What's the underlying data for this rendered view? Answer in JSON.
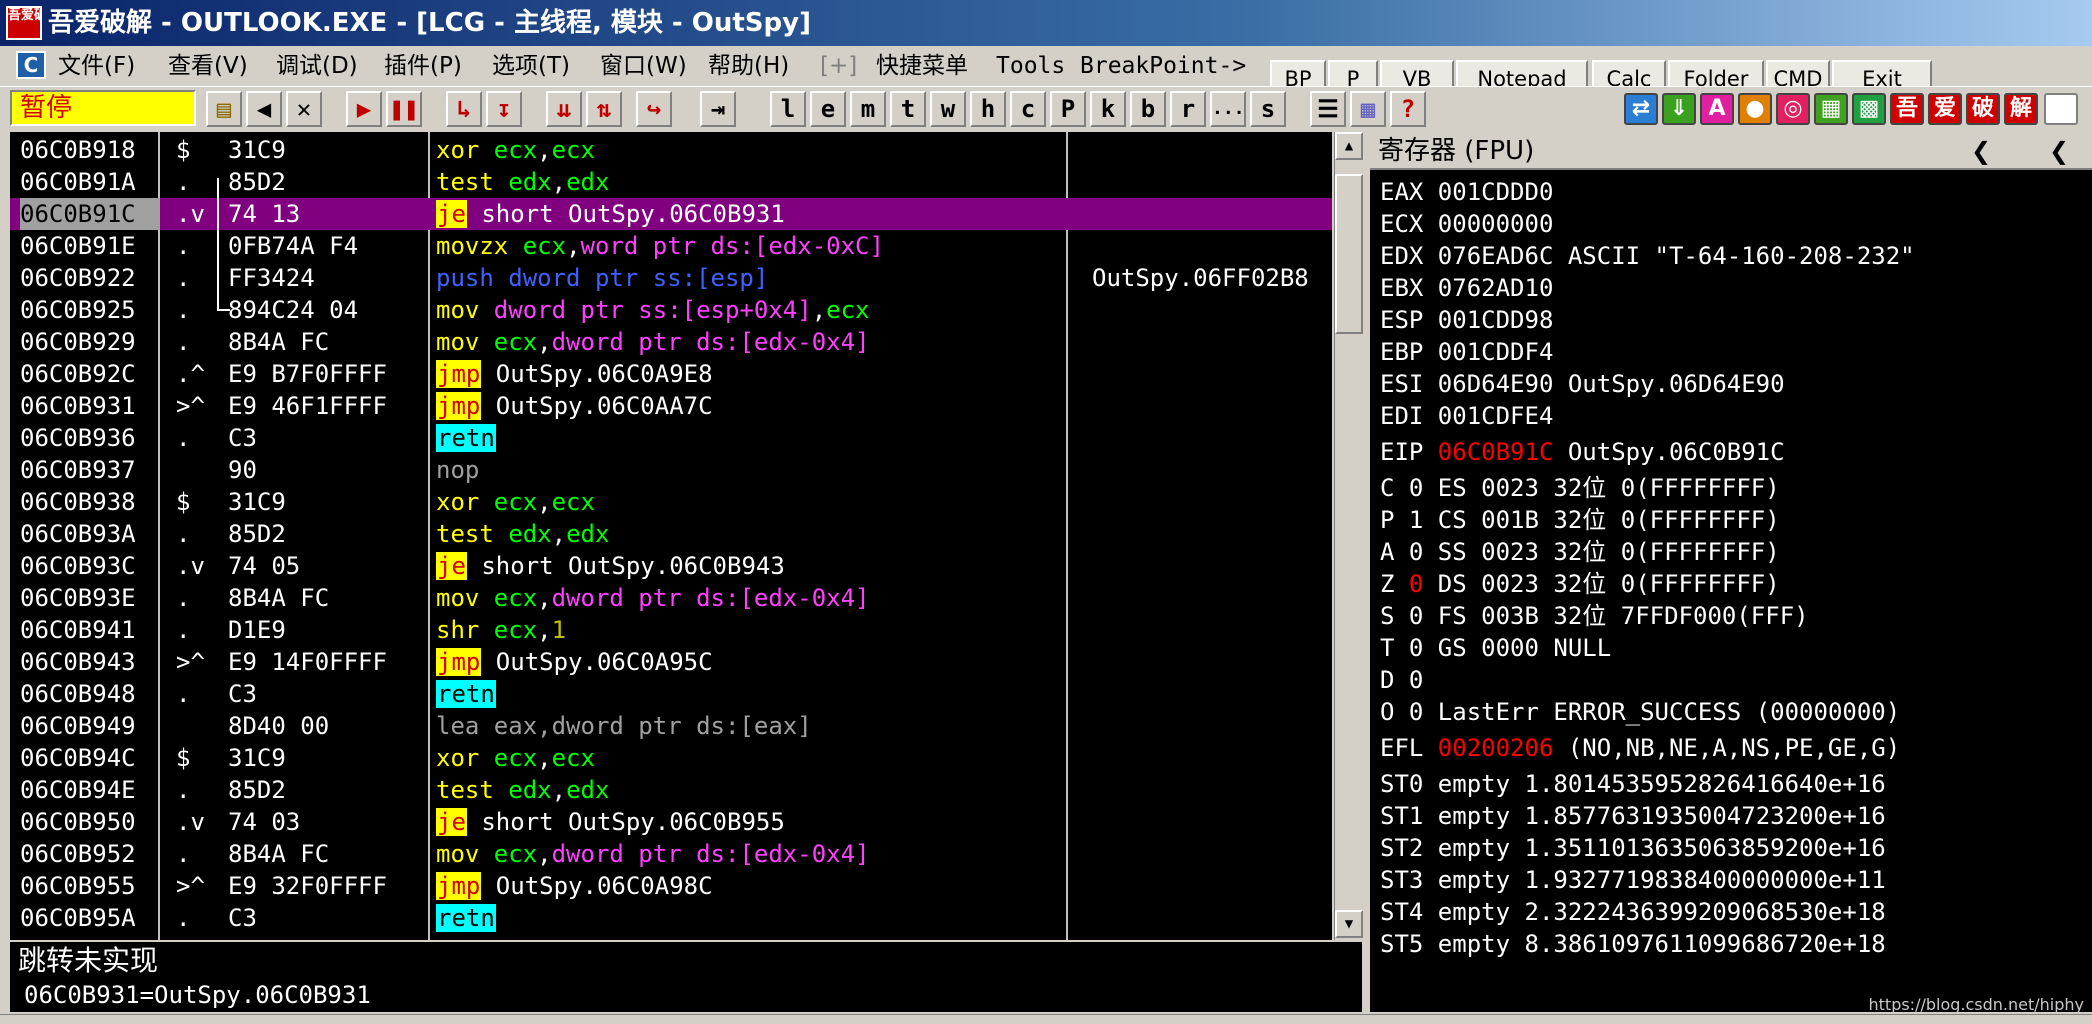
{
  "window": {
    "app_icon_text": "吾爱破解",
    "title": "吾爱破解 - OUTLOOK.EXE - [LCG - 主线程, 模块 - OutSpy]"
  },
  "menu": {
    "sys_icon": "C",
    "items": [
      "文件(F)",
      "查看(V)",
      "调试(D)",
      "插件(P)",
      "选项(T)",
      "窗口(W)",
      "帮助(H)",
      "[+]",
      "快捷菜单",
      "Tools",
      "BreakPoint->"
    ]
  },
  "quick_buttons": [
    "BP",
    "P",
    "VB",
    "Notepad",
    "Calc",
    "Folder",
    "CMD",
    "Exit"
  ],
  "toolbar": {
    "status": "暂停",
    "letters": [
      "l",
      "e",
      "m",
      "t",
      "w",
      "h",
      "c",
      "P",
      "k",
      "b",
      "r",
      "...",
      "s"
    ],
    "plugin_labels": [
      "A",
      "吾",
      "爱",
      "破",
      "解"
    ]
  },
  "disasm": {
    "rows": [
      {
        "addr": "06C0B918",
        "mark": "$",
        "hex": "31C9",
        "asm": [
          {
            "t": "xor ",
            "c": "yellow"
          },
          {
            "t": "ecx",
            "c": "green"
          },
          {
            "t": ",",
            "c": "white"
          },
          {
            "t": "ecx",
            "c": "green"
          }
        ],
        "comment": ""
      },
      {
        "addr": "06C0B91A",
        "mark": ".",
        "hex": "85D2",
        "asm": [
          {
            "t": "test ",
            "c": "yellow"
          },
          {
            "t": "edx",
            "c": "green"
          },
          {
            "t": ",",
            "c": "white"
          },
          {
            "t": "edx",
            "c": "green"
          }
        ],
        "comment": ""
      },
      {
        "addr": "06C0B91C",
        "mark": ".v",
        "hex": "74 13",
        "asm": [
          {
            "t": "je",
            "c": "jbox"
          },
          {
            "t": " short OutSpy.06C0B931",
            "c": "white"
          }
        ],
        "comment": "",
        "selected": true,
        "current": true
      },
      {
        "addr": "06C0B91E",
        "mark": ".",
        "hex": "0FB74A F4",
        "asm": [
          {
            "t": "movzx ",
            "c": "yellow"
          },
          {
            "t": "ecx",
            "c": "green"
          },
          {
            "t": ",",
            "c": "white"
          },
          {
            "t": "word ptr ds:[edx-0xC]",
            "c": "mag"
          }
        ],
        "comment": ""
      },
      {
        "addr": "06C0B922",
        "mark": ".",
        "hex": "FF3424",
        "asm": [
          {
            "t": "push dword ptr ss:[esp]",
            "c": "blue"
          }
        ],
        "comment": "OutSpy.06FF02B8"
      },
      {
        "addr": "06C0B925",
        "mark": ".",
        "hex": "894C24 04",
        "asm": [
          {
            "t": "mov ",
            "c": "yellow"
          },
          {
            "t": "dword ptr ss:[esp+0x4]",
            "c": "mag"
          },
          {
            "t": ",",
            "c": "white"
          },
          {
            "t": "ecx",
            "c": "green"
          }
        ],
        "comment": ""
      },
      {
        "addr": "06C0B929",
        "mark": ".",
        "hex": "8B4A FC",
        "asm": [
          {
            "t": "mov ",
            "c": "yellow"
          },
          {
            "t": "ecx",
            "c": "green"
          },
          {
            "t": ",",
            "c": "white"
          },
          {
            "t": "dword ptr ds:[edx-0x4]",
            "c": "mag"
          }
        ],
        "comment": ""
      },
      {
        "addr": "06C0B92C",
        "mark": ".^",
        "hex": "E9 B7F0FFFF",
        "asm": [
          {
            "t": "jmp",
            "c": "jbox"
          },
          {
            "t": " OutSpy.06C0A9E8",
            "c": "white"
          }
        ],
        "comment": ""
      },
      {
        "addr": "06C0B931",
        "mark": ">^",
        "hex": "E9 46F1FFFF",
        "asm": [
          {
            "t": "jmp",
            "c": "jbox"
          },
          {
            "t": " OutSpy.06C0AA7C",
            "c": "white"
          }
        ],
        "comment": ""
      },
      {
        "addr": "06C0B936",
        "mark": ".",
        "hex": "C3",
        "asm": [
          {
            "t": "retn",
            "c": "rbox"
          }
        ],
        "comment": ""
      },
      {
        "addr": "06C0B937",
        "mark": "",
        "hex": "90",
        "asm": [
          {
            "t": "nop",
            "c": "gray"
          }
        ],
        "comment": ""
      },
      {
        "addr": "06C0B938",
        "mark": "$",
        "hex": "31C9",
        "asm": [
          {
            "t": "xor ",
            "c": "yellow"
          },
          {
            "t": "ecx",
            "c": "green"
          },
          {
            "t": ",",
            "c": "white"
          },
          {
            "t": "ecx",
            "c": "green"
          }
        ],
        "comment": ""
      },
      {
        "addr": "06C0B93A",
        "mark": ".",
        "hex": "85D2",
        "asm": [
          {
            "t": "test ",
            "c": "yellow"
          },
          {
            "t": "edx",
            "c": "green"
          },
          {
            "t": ",",
            "c": "white"
          },
          {
            "t": "edx",
            "c": "green"
          }
        ],
        "comment": ""
      },
      {
        "addr": "06C0B93C",
        "mark": ".v",
        "hex": "74 05",
        "asm": [
          {
            "t": "je",
            "c": "jbox"
          },
          {
            "t": " short OutSpy.06C0B943",
            "c": "white"
          }
        ],
        "comment": ""
      },
      {
        "addr": "06C0B93E",
        "mark": ".",
        "hex": "8B4A FC",
        "asm": [
          {
            "t": "mov ",
            "c": "yellow"
          },
          {
            "t": "ecx",
            "c": "green"
          },
          {
            "t": ",",
            "c": "white"
          },
          {
            "t": "dword ptr ds:[edx-0x4]",
            "c": "mag"
          }
        ],
        "comment": ""
      },
      {
        "addr": "06C0B941",
        "mark": ".",
        "hex": "D1E9",
        "asm": [
          {
            "t": "shr ",
            "c": "yellow"
          },
          {
            "t": "ecx",
            "c": "green"
          },
          {
            "t": ",",
            "c": "white"
          },
          {
            "t": "1",
            "c": "olive"
          }
        ],
        "comment": ""
      },
      {
        "addr": "06C0B943",
        "mark": ">^",
        "hex": "E9 14F0FFFF",
        "asm": [
          {
            "t": "jmp",
            "c": "jbox"
          },
          {
            "t": " OutSpy.06C0A95C",
            "c": "white"
          }
        ],
        "comment": ""
      },
      {
        "addr": "06C0B948",
        "mark": ".",
        "hex": "C3",
        "asm": [
          {
            "t": "retn",
            "c": "rbox"
          }
        ],
        "comment": ""
      },
      {
        "addr": "06C0B949",
        "mark": "",
        "hex": "8D40 00",
        "asm": [
          {
            "t": "lea eax,dword ptr ds:[eax]",
            "c": "gray"
          }
        ],
        "comment": ""
      },
      {
        "addr": "06C0B94C",
        "mark": "$",
        "hex": "31C9",
        "asm": [
          {
            "t": "xor ",
            "c": "yellow"
          },
          {
            "t": "ecx",
            "c": "green"
          },
          {
            "t": ",",
            "c": "white"
          },
          {
            "t": "ecx",
            "c": "green"
          }
        ],
        "comment": ""
      },
      {
        "addr": "06C0B94E",
        "mark": ".",
        "hex": "85D2",
        "asm": [
          {
            "t": "test ",
            "c": "yellow"
          },
          {
            "t": "edx",
            "c": "green"
          },
          {
            "t": ",",
            "c": "white"
          },
          {
            "t": "edx",
            "c": "green"
          }
        ],
        "comment": ""
      },
      {
        "addr": "06C0B950",
        "mark": ".v",
        "hex": "74 03",
        "asm": [
          {
            "t": "je",
            "c": "jbox"
          },
          {
            "t": " short OutSpy.06C0B955",
            "c": "white"
          }
        ],
        "comment": ""
      },
      {
        "addr": "06C0B952",
        "mark": ".",
        "hex": "8B4A FC",
        "asm": [
          {
            "t": "mov ",
            "c": "yellow"
          },
          {
            "t": "ecx",
            "c": "green"
          },
          {
            "t": ",",
            "c": "white"
          },
          {
            "t": "dword ptr ds:[edx-0x4]",
            "c": "mag"
          }
        ],
        "comment": ""
      },
      {
        "addr": "06C0B955",
        "mark": ">^",
        "hex": "E9 32F0FFFF",
        "asm": [
          {
            "t": "jmp",
            "c": "jbox"
          },
          {
            "t": " OutSpy.06C0A98C",
            "c": "white"
          }
        ],
        "comment": ""
      },
      {
        "addr": "06C0B95A",
        "mark": ".",
        "hex": "C3",
        "asm": [
          {
            "t": "retn",
            "c": "rbox"
          }
        ],
        "comment": ""
      }
    ]
  },
  "info_pane": {
    "line1": "跳转未实现",
    "line2": "06C0B931=OutSpy.06C0B931"
  },
  "registers": {
    "header": "寄存器 (FPU)",
    "general": [
      {
        "name": "EAX",
        "value": "001CDDD0",
        "note": ""
      },
      {
        "name": "ECX",
        "value": "00000000",
        "note": ""
      },
      {
        "name": "EDX",
        "value": "076EAD6C",
        "note": "ASCII \"T-64-160-208-232\""
      },
      {
        "name": "EBX",
        "value": "0762AD10",
        "note": ""
      },
      {
        "name": "ESP",
        "value": "001CDD98",
        "note": ""
      },
      {
        "name": "EBP",
        "value": "001CDDF4",
        "note": ""
      },
      {
        "name": "ESI",
        "value": "06D64E90",
        "note": "OutSpy.06D64E90"
      },
      {
        "name": "EDI",
        "value": "001CDFE4",
        "note": ""
      }
    ],
    "eip": {
      "name": "EIP",
      "value": "06C0B91C",
      "note": "OutSpy.06C0B91C"
    },
    "flags": [
      {
        "flag": "C",
        "val": "0",
        "seg": "ES 0023 32位 0(FFFFFFFF)",
        "changed": false
      },
      {
        "flag": "P",
        "val": "1",
        "seg": "CS 001B 32位 0(FFFFFFFF)",
        "changed": false
      },
      {
        "flag": "A",
        "val": "0",
        "seg": "SS 0023 32位 0(FFFFFFFF)",
        "changed": false
      },
      {
        "flag": "Z",
        "val": "0",
        "seg": "DS 0023 32位 0(FFFFFFFF)",
        "changed": true
      },
      {
        "flag": "S",
        "val": "0",
        "seg": "FS 003B 32位 7FFDF000(FFF)",
        "changed": false
      },
      {
        "flag": "T",
        "val": "0",
        "seg": "GS 0000 NULL",
        "changed": false
      },
      {
        "flag": "D",
        "val": "0",
        "seg": "",
        "changed": false
      },
      {
        "flag": "O",
        "val": "0",
        "seg": "LastErr ERROR_SUCCESS (00000000)",
        "changed": false
      }
    ],
    "efl": {
      "name": "EFL",
      "value": "00200206",
      "note": "(NO,NB,NE,A,NS,PE,GE,G)"
    },
    "fpu": [
      {
        "name": "ST0",
        "state": "empty",
        "value": "1.8014535952826416640e+16"
      },
      {
        "name": "ST1",
        "state": "empty",
        "value": "1.8577631935004723200e+16"
      },
      {
        "name": "ST2",
        "state": "empty",
        "value": "1.3511013635063859200e+16"
      },
      {
        "name": "ST3",
        "state": "empty",
        "value": "1.9327719838400000000e+11"
      },
      {
        "name": "ST4",
        "state": "empty",
        "value": "2.3222436399209068530e+18"
      },
      {
        "name": "ST5",
        "state": "empty",
        "value": "8.3861097611099686720e+18"
      }
    ]
  },
  "watermark": "https://blog.csdn.net/hiphy",
  "colors": {
    "selected_row": "#800080",
    "register_changed": "#ff0000",
    "pause_bg": "#ffff00"
  }
}
